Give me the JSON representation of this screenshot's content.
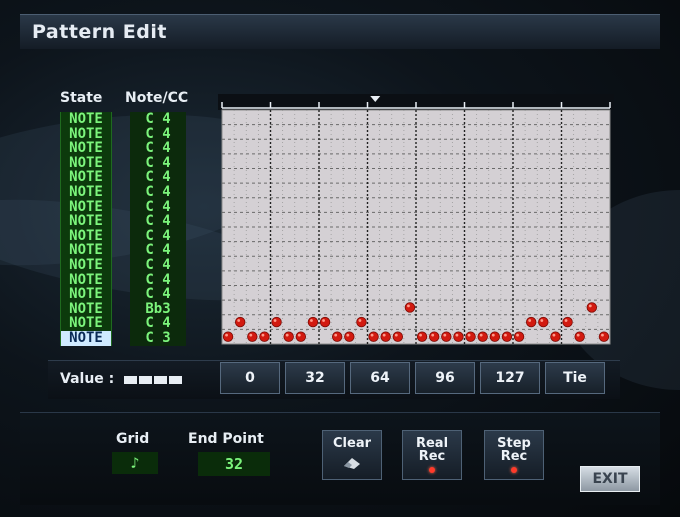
{
  "title": "Pattern Edit",
  "headers": {
    "state": "State",
    "note_cc": "Note/CC"
  },
  "rows": [
    {
      "state": "NOTE",
      "note": "C  4"
    },
    {
      "state": "NOTE",
      "note": "C  4"
    },
    {
      "state": "NOTE",
      "note": "C  4"
    },
    {
      "state": "NOTE",
      "note": "C  4"
    },
    {
      "state": "NOTE",
      "note": "C  4"
    },
    {
      "state": "NOTE",
      "note": "C  4"
    },
    {
      "state": "NOTE",
      "note": "C  4"
    },
    {
      "state": "NOTE",
      "note": "C  4"
    },
    {
      "state": "NOTE",
      "note": "C  4"
    },
    {
      "state": "NOTE",
      "note": "C  4"
    },
    {
      "state": "NOTE",
      "note": "C  4"
    },
    {
      "state": "NOTE",
      "note": "C  4"
    },
    {
      "state": "NOTE",
      "note": "C  4"
    },
    {
      "state": "NOTE",
      "note": "Bb3"
    },
    {
      "state": "NOTE",
      "note": "C  4"
    },
    {
      "state": "NOTE",
      "note": "C  3"
    }
  ],
  "selected_row": 15,
  "grid": {
    "steps": 32,
    "beats": 8,
    "notes": [
      {
        "row": 13,
        "steps": [
          15,
          30
        ]
      },
      {
        "row": 14,
        "steps": [
          1,
          4,
          7,
          8,
          11,
          25,
          26,
          28
        ]
      },
      {
        "row": 15,
        "steps": [
          0,
          2,
          3,
          5,
          6,
          9,
          10,
          12,
          13,
          14,
          16,
          17,
          18,
          19,
          20,
          21,
          22,
          23,
          24,
          27,
          29,
          31
        ]
      }
    ],
    "colors": {
      "background": "#d4d0d4",
      "note": "#d21a10"
    }
  },
  "value": {
    "label": "Value :",
    "buttons": [
      "0",
      "32",
      "64",
      "96",
      "127",
      "Tie"
    ]
  },
  "grid_setting": {
    "label": "Grid",
    "value": "♪"
  },
  "end_point": {
    "label": "End Point",
    "value": "32"
  },
  "actions": {
    "clear": "Clear",
    "real_rec_line1": "Real",
    "real_rec_line2": "Rec",
    "step_rec_line1": "Step",
    "step_rec_line2": "Rec"
  },
  "exit_label": "EXIT",
  "colors": {
    "accent_green": "#7cf47c",
    "panel_dark": "#0b1016"
  }
}
